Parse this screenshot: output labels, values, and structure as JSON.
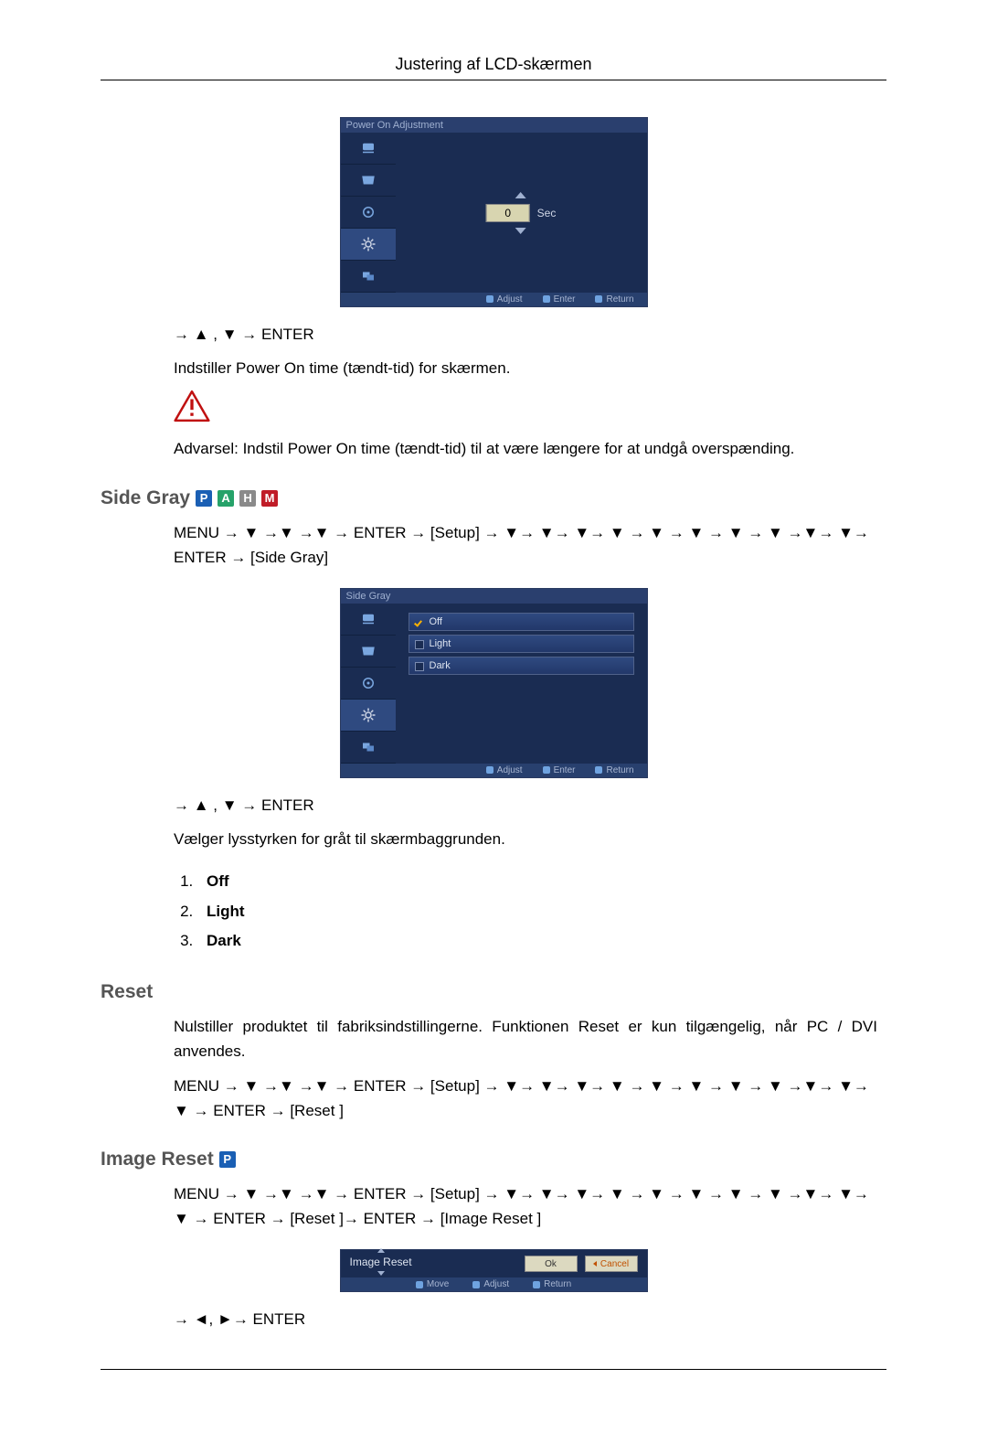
{
  "page": {
    "title": "Justering af LCD-skærmen"
  },
  "power_on": {
    "osd_title": "Power On Adjustment",
    "value": "0",
    "unit": "Sec",
    "footer": {
      "adjust": "Adjust",
      "enter": "Enter",
      "return": "Return"
    },
    "line_nav": "→ ▲ , ▼ → ENTER",
    "line_desc": "Indstiller Power On time (tændt-tid) for skærmen.",
    "line_warn": "Advarsel: Indstil Power On time (tændt-tid) til at være længere for at undgå overspænding."
  },
  "side_gray": {
    "heading": "Side Gray",
    "badges": [
      "P",
      "A",
      "H",
      "M"
    ],
    "line_path": "MENU → ▼ →▼ →▼ → ENTER → [Setup] → ▼→ ▼→ ▼→ ▼ → ▼ → ▼ → ▼ → ▼ →▼→ ▼→ ENTER → [Side Gray]",
    "osd_title": "Side Gray",
    "options": [
      {
        "label": "Off",
        "checked": true
      },
      {
        "label": "Light",
        "checked": false
      },
      {
        "label": "Dark",
        "checked": false
      }
    ],
    "footer": {
      "adjust": "Adjust",
      "enter": "Enter",
      "return": "Return"
    },
    "line_nav": "→ ▲ , ▼ → ENTER",
    "line_desc": "Vælger lysstyrken for gråt til skærmbaggrunden.",
    "list": [
      "Off",
      "Light",
      "Dark"
    ]
  },
  "reset": {
    "heading": "Reset",
    "line_desc": "Nulstiller produktet til fabriksindstillingerne. Funktionen Reset er kun tilgængelig, når PC / DVI anvendes.",
    "line_path": "MENU → ▼ →▼ →▼ → ENTER → [Setup] → ▼→ ▼→ ▼→ ▼ → ▼ → ▼ → ▼ → ▼ →▼→ ▼→ ▼ → ENTER → [Reset ]"
  },
  "image_reset": {
    "heading": "Image Reset",
    "badges": [
      "P"
    ],
    "line_path": "MENU → ▼ →▼ →▼ → ENTER → [Setup] → ▼→ ▼→ ▼→ ▼ → ▼ → ▼ → ▼ → ▼ →▼→ ▼→ ▼ → ENTER → [Reset ]→ ENTER → [Image Reset ]",
    "dlg_title": "Image Reset",
    "btn_ok": "Ok",
    "btn_cancel": "Cancel",
    "footer": {
      "move": "Move",
      "adjust": "Adjust",
      "return": "Return"
    },
    "line_nav": "→ ◄, ►→ ENTER"
  }
}
